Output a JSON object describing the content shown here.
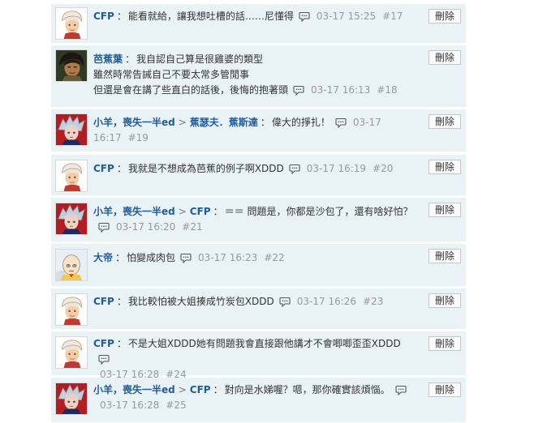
{
  "delete_label": "刪除",
  "comments": [
    {
      "author": "CFP",
      "reply_to": "",
      "lines": [
        "能看就給，讓我想吐槽的話……尼懂得"
      ],
      "time": "03-17 15:25",
      "floor": "#17",
      "avatar": "white-hair-boy"
    },
    {
      "author": "芭蕉葉",
      "reply_to": "",
      "lines": [
        "我自認自己算是很雞婆的類型",
        "雖然時常告誡自己不要太常多管閒事",
        "但還是會在講了些直白的話後，後悔的抱著頭"
      ],
      "time": "03-17 16:13",
      "floor": "#18",
      "avatar": "dark-hair-man"
    },
    {
      "author": "小羊，喪失一半ed",
      "reply_to": "蕉瑟夫．蕉斯達",
      "lines": [
        "偉大的掙扎！"
      ],
      "time": "03-17 16:17",
      "floor": "#19",
      "avatar": "grey-hair-elf"
    },
    {
      "author": "CFP",
      "reply_to": "",
      "lines": [
        "我就是不想成為芭蕉的例子啊XDDD"
      ],
      "time": "03-17 16:19",
      "floor": "#20",
      "avatar": "white-hair-boy"
    },
    {
      "author": "小羊，喪失一半ed",
      "reply_to": "CFP",
      "lines": [
        "＝＝ 問題是，你都是沙包了，還有啥好怕？"
      ],
      "time": "03-17 16:20",
      "floor": "#21",
      "avatar": "grey-hair-elf"
    },
    {
      "author": "大帝",
      "reply_to": "",
      "lines": [
        "怕變成肉包"
      ],
      "time": "03-17 16:23",
      "floor": "#22",
      "avatar": "bald-hero"
    },
    {
      "author": "CFP",
      "reply_to": "",
      "lines": [
        "我比較怕被大姐揍成竹炭包XDDD"
      ],
      "time": "03-17 16:26",
      "floor": "#23",
      "avatar": "white-hair-boy"
    },
    {
      "author": "CFP",
      "reply_to": "",
      "lines": [
        "不是大姐XDDD她有問題我會直接跟他講才不會唧唧歪歪XDDD"
      ],
      "time": "03-17 16:28",
      "floor": "#24",
      "avatar": "white-hair-boy"
    },
    {
      "author": "小羊，喪失一半ed",
      "reply_to": "CFP",
      "lines": [
        "對向是水娣喔？嗯，那你確實該煩惱。"
      ],
      "time": "03-17 16:28",
      "floor": "#25",
      "avatar": "grey-hair-elf"
    }
  ]
}
